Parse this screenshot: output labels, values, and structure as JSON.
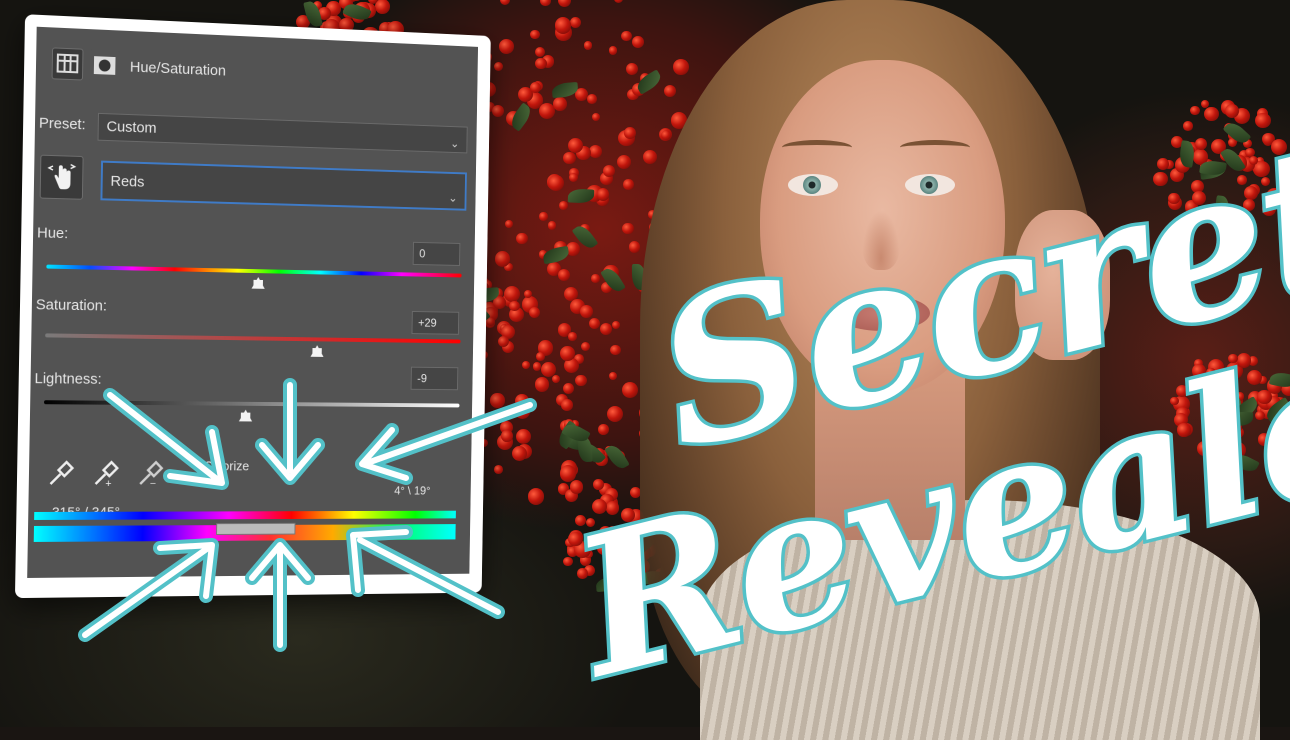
{
  "panel": {
    "title": "Hue/Saturation",
    "preset_label": "Preset:",
    "preset_value": "Custom",
    "channel_value": "Reds",
    "hue": {
      "label": "Hue:",
      "value": "0",
      "fraction": 0.5
    },
    "saturation": {
      "label": "Saturation:",
      "value": "+29",
      "fraction": 0.645
    },
    "lightness": {
      "label": "Lightness:",
      "value": "-9",
      "fraction": 0.475
    },
    "colorize_label": "Colorize",
    "range_left": "315° / 345°",
    "range_right": "4° \\ 19°"
  },
  "icons": {
    "adjustment": "levels-grid-icon",
    "mask": "layer-mask-icon",
    "targeted_adjust": "hand-targeted-adjust-icon",
    "eyedropper": "eyedropper-icon",
    "eyedropper_add": "eyedropper-add-icon",
    "eyedropper_subtract": "eyedropper-subtract-icon",
    "dropdown": "chevron-down-icon"
  },
  "headline": {
    "line1": "Secrets",
    "line2": "Revealed"
  },
  "colors": {
    "accent": "#53c1c8",
    "panel_bg": "#535353",
    "headline_fill": "#ffffff"
  }
}
